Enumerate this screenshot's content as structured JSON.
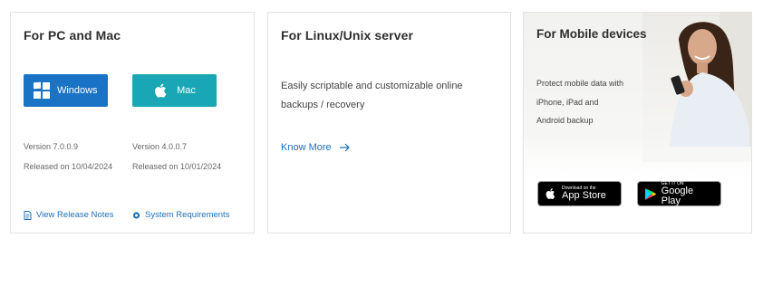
{
  "pc_card": {
    "title": "For PC and Mac",
    "windows_button": "Windows",
    "mac_button": "Mac",
    "windows_version": "Version 7.0.0.9",
    "windows_released": "Released on 10/04/2024",
    "mac_version": "Version 4.0.0.7",
    "mac_released": "Released on 10/01/2024",
    "release_notes_link": "View Release Notes",
    "system_requirements_link": "System Requirements"
  },
  "linux_card": {
    "title": "For Linux/Unix server",
    "description": "Easily scriptable and customizable online backups / recovery",
    "know_more_link": "Know More"
  },
  "mobile_card": {
    "title": "For Mobile devices",
    "description_lines": [
      "Protect mobile data with",
      "iPhone, iPad and",
      "Android backup"
    ],
    "app_store_small": "Download on the",
    "app_store_big": "App Store",
    "google_play_small": "GET IT ON",
    "google_play_big": "Google Play"
  },
  "colors": {
    "windows_button": "#1a73c5",
    "mac_button": "#1aa7b5",
    "link": "#1e6fb8"
  }
}
